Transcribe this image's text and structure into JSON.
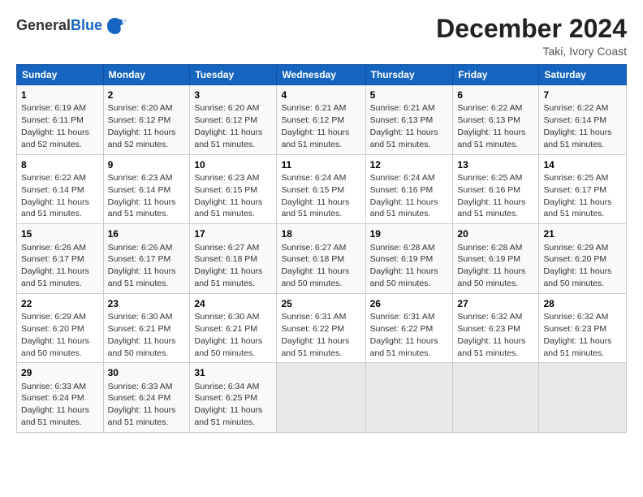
{
  "header": {
    "logo_general": "General",
    "logo_blue": "Blue",
    "month_title": "December 2024",
    "location": "Taki, Ivory Coast"
  },
  "calendar": {
    "days_of_week": [
      "Sunday",
      "Monday",
      "Tuesday",
      "Wednesday",
      "Thursday",
      "Friday",
      "Saturday"
    ],
    "weeks": [
      [
        {
          "day": "1",
          "info": "Sunrise: 6:19 AM\nSunset: 6:11 PM\nDaylight: 11 hours\nand 52 minutes."
        },
        {
          "day": "2",
          "info": "Sunrise: 6:20 AM\nSunset: 6:12 PM\nDaylight: 11 hours\nand 52 minutes."
        },
        {
          "day": "3",
          "info": "Sunrise: 6:20 AM\nSunset: 6:12 PM\nDaylight: 11 hours\nand 51 minutes."
        },
        {
          "day": "4",
          "info": "Sunrise: 6:21 AM\nSunset: 6:12 PM\nDaylight: 11 hours\nand 51 minutes."
        },
        {
          "day": "5",
          "info": "Sunrise: 6:21 AM\nSunset: 6:13 PM\nDaylight: 11 hours\nand 51 minutes."
        },
        {
          "day": "6",
          "info": "Sunrise: 6:22 AM\nSunset: 6:13 PM\nDaylight: 11 hours\nand 51 minutes."
        },
        {
          "day": "7",
          "info": "Sunrise: 6:22 AM\nSunset: 6:14 PM\nDaylight: 11 hours\nand 51 minutes."
        }
      ],
      [
        {
          "day": "8",
          "info": "Sunrise: 6:22 AM\nSunset: 6:14 PM\nDaylight: 11 hours\nand 51 minutes."
        },
        {
          "day": "9",
          "info": "Sunrise: 6:23 AM\nSunset: 6:14 PM\nDaylight: 11 hours\nand 51 minutes."
        },
        {
          "day": "10",
          "info": "Sunrise: 6:23 AM\nSunset: 6:15 PM\nDaylight: 11 hours\nand 51 minutes."
        },
        {
          "day": "11",
          "info": "Sunrise: 6:24 AM\nSunset: 6:15 PM\nDaylight: 11 hours\nand 51 minutes."
        },
        {
          "day": "12",
          "info": "Sunrise: 6:24 AM\nSunset: 6:16 PM\nDaylight: 11 hours\nand 51 minutes."
        },
        {
          "day": "13",
          "info": "Sunrise: 6:25 AM\nSunset: 6:16 PM\nDaylight: 11 hours\nand 51 minutes."
        },
        {
          "day": "14",
          "info": "Sunrise: 6:25 AM\nSunset: 6:17 PM\nDaylight: 11 hours\nand 51 minutes."
        }
      ],
      [
        {
          "day": "15",
          "info": "Sunrise: 6:26 AM\nSunset: 6:17 PM\nDaylight: 11 hours\nand 51 minutes."
        },
        {
          "day": "16",
          "info": "Sunrise: 6:26 AM\nSunset: 6:17 PM\nDaylight: 11 hours\nand 51 minutes."
        },
        {
          "day": "17",
          "info": "Sunrise: 6:27 AM\nSunset: 6:18 PM\nDaylight: 11 hours\nand 51 minutes."
        },
        {
          "day": "18",
          "info": "Sunrise: 6:27 AM\nSunset: 6:18 PM\nDaylight: 11 hours\nand 50 minutes."
        },
        {
          "day": "19",
          "info": "Sunrise: 6:28 AM\nSunset: 6:19 PM\nDaylight: 11 hours\nand 50 minutes."
        },
        {
          "day": "20",
          "info": "Sunrise: 6:28 AM\nSunset: 6:19 PM\nDaylight: 11 hours\nand 50 minutes."
        },
        {
          "day": "21",
          "info": "Sunrise: 6:29 AM\nSunset: 6:20 PM\nDaylight: 11 hours\nand 50 minutes."
        }
      ],
      [
        {
          "day": "22",
          "info": "Sunrise: 6:29 AM\nSunset: 6:20 PM\nDaylight: 11 hours\nand 50 minutes."
        },
        {
          "day": "23",
          "info": "Sunrise: 6:30 AM\nSunset: 6:21 PM\nDaylight: 11 hours\nand 50 minutes."
        },
        {
          "day": "24",
          "info": "Sunrise: 6:30 AM\nSunset: 6:21 PM\nDaylight: 11 hours\nand 50 minutes."
        },
        {
          "day": "25",
          "info": "Sunrise: 6:31 AM\nSunset: 6:22 PM\nDaylight: 11 hours\nand 51 minutes."
        },
        {
          "day": "26",
          "info": "Sunrise: 6:31 AM\nSunset: 6:22 PM\nDaylight: 11 hours\nand 51 minutes."
        },
        {
          "day": "27",
          "info": "Sunrise: 6:32 AM\nSunset: 6:23 PM\nDaylight: 11 hours\nand 51 minutes."
        },
        {
          "day": "28",
          "info": "Sunrise: 6:32 AM\nSunset: 6:23 PM\nDaylight: 11 hours\nand 51 minutes."
        }
      ],
      [
        {
          "day": "29",
          "info": "Sunrise: 6:33 AM\nSunset: 6:24 PM\nDaylight: 11 hours\nand 51 minutes."
        },
        {
          "day": "30",
          "info": "Sunrise: 6:33 AM\nSunset: 6:24 PM\nDaylight: 11 hours\nand 51 minutes."
        },
        {
          "day": "31",
          "info": "Sunrise: 6:34 AM\nSunset: 6:25 PM\nDaylight: 11 hours\nand 51 minutes."
        },
        {
          "day": "",
          "info": ""
        },
        {
          "day": "",
          "info": ""
        },
        {
          "day": "",
          "info": ""
        },
        {
          "day": "",
          "info": ""
        }
      ]
    ]
  }
}
